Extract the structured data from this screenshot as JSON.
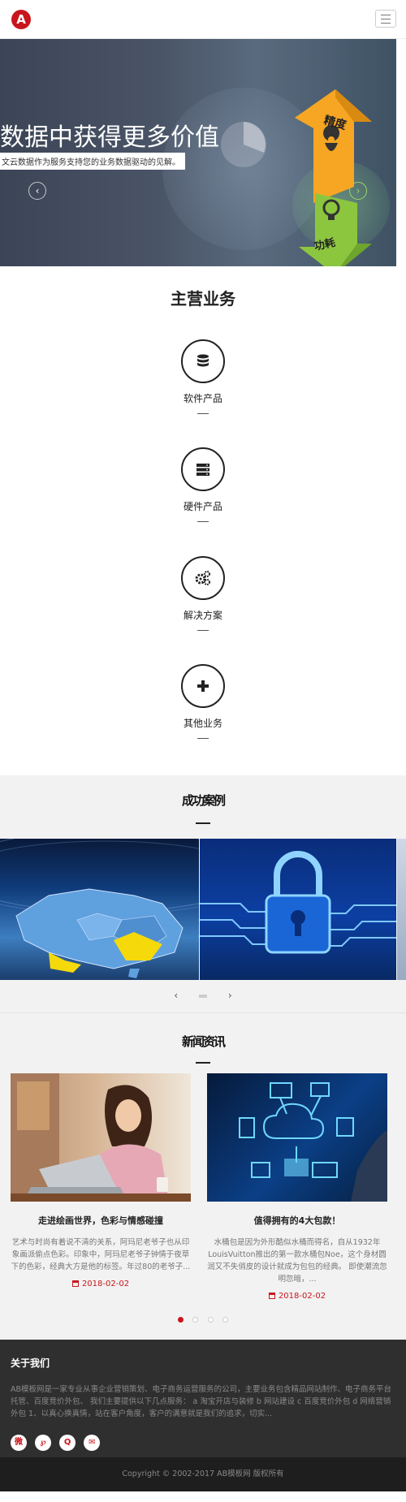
{
  "header": {
    "logo_icon": "logo-a-icon",
    "menu_icon": "hamburger-menu-icon"
  },
  "banner": {
    "title": "数据中获得更多价值",
    "subtitle": "文云数据作为服务支持您的业务数据驱动的见解。",
    "arrow_up_text": "精度",
    "arrow_down_text": "功耗"
  },
  "business": {
    "title": "主营业务",
    "items": [
      {
        "label": "软件产品",
        "icon": "database-icon"
      },
      {
        "label": "硬件产品",
        "icon": "server-icon"
      },
      {
        "label": "解决方案",
        "icon": "gears-icon"
      },
      {
        "label": "其他业务",
        "icon": "plus-icon"
      }
    ]
  },
  "cases": {
    "title": "成功案例",
    "prev": "‹",
    "next": "›"
  },
  "news": {
    "title": "新闻资讯",
    "items": [
      {
        "headline": "走进绘画世界，色彩与情感碰撞",
        "desc": "艺术与时尚有着说不清的关系，阿玛尼老爷子也从印象画派偷点色彩。印象中，阿玛尼老爷子钟情于夜草下的色彩，经典大方是他的标签。年过80的老爷子...",
        "date": "2018-02-02"
      },
      {
        "headline": "值得拥有的4大包款！",
        "desc": "水桶包是因为外形酷似水桶而得名，自从1932年LouisVuitton推出的第一款水桶包Noe，这个身材圆润又不失俏皮的设计就成为包包的经典。 即使潮流忽明忽暗，...",
        "date": "2018-02-02"
      }
    ]
  },
  "footer": {
    "about_title": "关于我们",
    "about_text": "AB模板网是一家专业从事企业营销策划、电子商务运营服务的公司，主要业务包含精品网站制作、电子商务平台托管、百度竞价外包、 我们主要提供以下几点服务： a 淘宝开店与装修 b 网站建设 c 百度竞价外包 d 网络营销外包 1、以真心换真情，站在客户角度，客户的满意就是我们的追求，切实...",
    "social": [
      {
        "icon": "weibo-icon",
        "glyph": "微"
      },
      {
        "icon": "tencent-weibo-icon",
        "glyph": "℘"
      },
      {
        "icon": "qq-icon",
        "glyph": "Q"
      },
      {
        "icon": "email-icon",
        "glyph": "✉"
      }
    ],
    "copyright": "Copyright © 2002-2017 AB模板网 版权所有"
  },
  "colors": {
    "brand_red": "#c8161d",
    "arrow_orange": "#f6a623",
    "arrow_green": "#8cc63f"
  }
}
